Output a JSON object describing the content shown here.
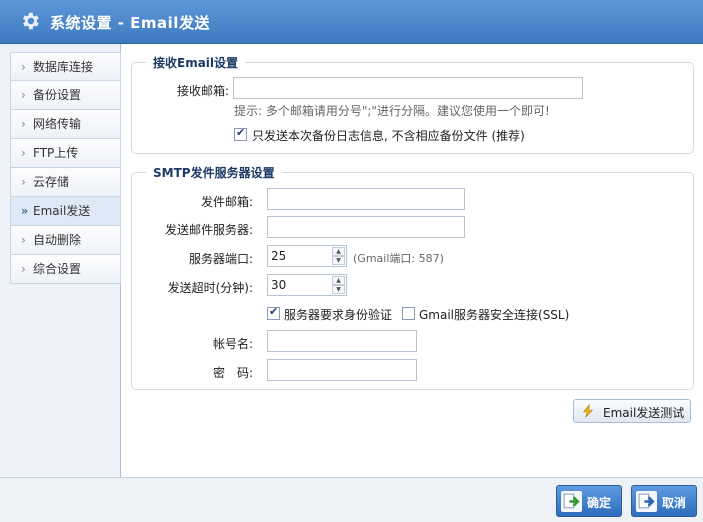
{
  "window": {
    "title": "系统设置 - Email发送"
  },
  "sidebar": {
    "items": [
      {
        "label": "数据库连接",
        "chevron": "›"
      },
      {
        "label": "备份设置",
        "chevron": "›"
      },
      {
        "label": "网络传输",
        "chevron": "›"
      },
      {
        "label": "FTP上传",
        "chevron": "›"
      },
      {
        "label": "云存储",
        "chevron": "›"
      },
      {
        "label": "Email发送",
        "chevron": "»",
        "active": true
      },
      {
        "label": "自动删除",
        "chevron": "›"
      },
      {
        "label": "综合设置",
        "chevron": "›"
      }
    ]
  },
  "receive": {
    "legend": "接收Email设置",
    "email_label": "接收邮箱:",
    "email_value": "",
    "hint": "提示: 多个邮箱请用分号\";\"进行分隔。建议您使用一个即可!",
    "log_only_label": "只发送本次备份日志信息, 不含相应备份文件 (推荐)",
    "log_only_checked": true
  },
  "smtp": {
    "legend": "SMTP发件服务器设置",
    "sender_label": "发件邮箱:",
    "sender_value": "",
    "server_label": "发送邮件服务器:",
    "server_value": "",
    "port_label": "服务器端口:",
    "port_value": "25",
    "port_hint": "(Gmail端口: 587)",
    "timeout_label": "发送超时(分钟):",
    "timeout_value": "30",
    "auth_label": "服务器要求身份验证",
    "auth_checked": true,
    "ssl_label": "Gmail服务器安全连接(SSL)",
    "ssl_checked": false,
    "account_label": "帐号名:",
    "account_value": "",
    "password_label": "密　码:",
    "password_value": ""
  },
  "test_button": {
    "label": "Email发送测试"
  },
  "footer": {
    "ok_label": "确定",
    "cancel_label": "取消"
  },
  "icons": {
    "title": "gear-icon",
    "test": "lightning-icon",
    "ok": "confirm-arrow-icon",
    "cancel": "cancel-arrow-icon"
  },
  "colors": {
    "titlebar": "#3f79c0",
    "primary_button": "#2e6cbd"
  }
}
